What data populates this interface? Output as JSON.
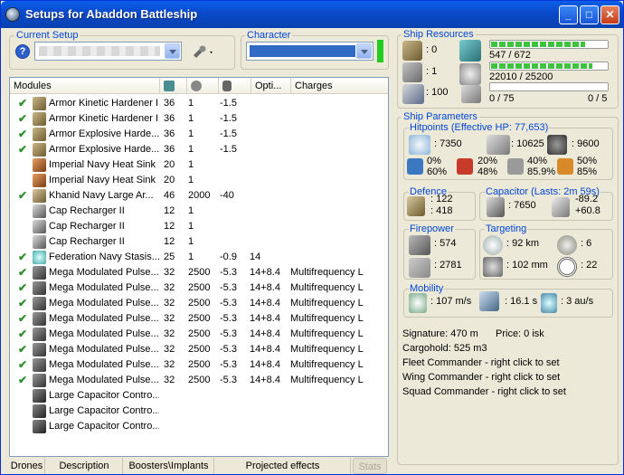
{
  "window": {
    "title": "Setups for Abaddon Battleship",
    "minimize": "_",
    "maximize": "□",
    "close": "✕"
  },
  "current_setup": {
    "label": "Current Setup",
    "value": "",
    "help": "?"
  },
  "character": {
    "label": "Character",
    "value": ""
  },
  "modules": {
    "columns": [
      "Modules",
      "",
      "",
      "",
      "Opti...",
      "Charges"
    ],
    "rows": [
      {
        "checked": true,
        "icon": "hardener-icon",
        "name": "Armor Kinetic Hardener II",
        "cpu": "36",
        "pg": "1",
        "cap": "-1.5",
        "opt": "",
        "charges": ""
      },
      {
        "checked": true,
        "icon": "hardener-icon",
        "name": "Armor Kinetic Hardener II",
        "cpu": "36",
        "pg": "1",
        "cap": "-1.5",
        "opt": "",
        "charges": ""
      },
      {
        "checked": true,
        "icon": "hardener-icon",
        "name": "Armor Explosive Harde...",
        "cpu": "36",
        "pg": "1",
        "cap": "-1.5",
        "opt": "",
        "charges": ""
      },
      {
        "checked": true,
        "icon": "hardener-icon",
        "name": "Armor Explosive Harde...",
        "cpu": "36",
        "pg": "1",
        "cap": "-1.5",
        "opt": "",
        "charges": ""
      },
      {
        "checked": false,
        "icon": "heatsink-icon",
        "name": "Imperial Navy Heat Sink",
        "cpu": "20",
        "pg": "1",
        "cap": "",
        "opt": "",
        "charges": ""
      },
      {
        "checked": false,
        "icon": "heatsink-icon",
        "name": "Imperial Navy Heat Sink",
        "cpu": "20",
        "pg": "1",
        "cap": "",
        "opt": "",
        "charges": ""
      },
      {
        "checked": true,
        "icon": "armor-repairer-icon",
        "name": "Khanid Navy Large Ar...",
        "cpu": "46",
        "pg": "2000",
        "cap": "-40",
        "opt": "",
        "charges": ""
      },
      {
        "checked": false,
        "icon": "cap-recharger-icon",
        "name": "Cap Recharger II",
        "cpu": "12",
        "pg": "1",
        "cap": "",
        "opt": "",
        "charges": ""
      },
      {
        "checked": false,
        "icon": "cap-recharger-icon",
        "name": "Cap Recharger II",
        "cpu": "12",
        "pg": "1",
        "cap": "",
        "opt": "",
        "charges": ""
      },
      {
        "checked": false,
        "icon": "cap-recharger-icon",
        "name": "Cap Recharger II",
        "cpu": "12",
        "pg": "1",
        "cap": "",
        "opt": "",
        "charges": ""
      },
      {
        "checked": true,
        "icon": "stasis-web-icon",
        "name": "Federation Navy Stasis...",
        "cpu": "25",
        "pg": "1",
        "cap": "-0.9",
        "opt": "14",
        "charges": ""
      },
      {
        "checked": true,
        "icon": "pulse-laser-icon",
        "name": "Mega Modulated Pulse...",
        "cpu": "32",
        "pg": "2500",
        "cap": "-5.3",
        "opt": "14+8.4",
        "charges": "Multifrequency L"
      },
      {
        "checked": true,
        "icon": "pulse-laser-icon",
        "name": "Mega Modulated Pulse...",
        "cpu": "32",
        "pg": "2500",
        "cap": "-5.3",
        "opt": "14+8.4",
        "charges": "Multifrequency L"
      },
      {
        "checked": true,
        "icon": "pulse-laser-icon",
        "name": "Mega Modulated Pulse...",
        "cpu": "32",
        "pg": "2500",
        "cap": "-5.3",
        "opt": "14+8.4",
        "charges": "Multifrequency L"
      },
      {
        "checked": true,
        "icon": "pulse-laser-icon",
        "name": "Mega Modulated Pulse...",
        "cpu": "32",
        "pg": "2500",
        "cap": "-5.3",
        "opt": "14+8.4",
        "charges": "Multifrequency L"
      },
      {
        "checked": true,
        "icon": "pulse-laser-icon",
        "name": "Mega Modulated Pulse...",
        "cpu": "32",
        "pg": "2500",
        "cap": "-5.3",
        "opt": "14+8.4",
        "charges": "Multifrequency L"
      },
      {
        "checked": true,
        "icon": "pulse-laser-icon",
        "name": "Mega Modulated Pulse...",
        "cpu": "32",
        "pg": "2500",
        "cap": "-5.3",
        "opt": "14+8.4",
        "charges": "Multifrequency L"
      },
      {
        "checked": true,
        "icon": "pulse-laser-icon",
        "name": "Mega Modulated Pulse...",
        "cpu": "32",
        "pg": "2500",
        "cap": "-5.3",
        "opt": "14+8.4",
        "charges": "Multifrequency L"
      },
      {
        "checked": true,
        "icon": "pulse-laser-icon",
        "name": "Mega Modulated Pulse...",
        "cpu": "32",
        "pg": "2500",
        "cap": "-5.3",
        "opt": "14+8.4",
        "charges": "Multifrequency L"
      },
      {
        "checked": false,
        "icon": "capacitor-control-icon",
        "name": "Large Capacitor Contro...",
        "cpu": "",
        "pg": "",
        "cap": "",
        "opt": "",
        "charges": ""
      },
      {
        "checked": false,
        "icon": "capacitor-control-icon",
        "name": "Large Capacitor Contro...",
        "cpu": "",
        "pg": "",
        "cap": "",
        "opt": "",
        "charges": ""
      },
      {
        "checked": false,
        "icon": "capacitor-control-icon",
        "name": "Large Capacitor Contro...",
        "cpu": "",
        "pg": "",
        "cap": "",
        "opt": "",
        "charges": ""
      }
    ]
  },
  "bottom_tabs": [
    "Drones",
    "Description",
    "Boosters\\Implants",
    "Projected effects",
    "Stats"
  ],
  "resources": {
    "label": "Ship Resources",
    "turret_slots": ": 0",
    "launcher_slots": ": 1",
    "calibration": ": 100",
    "cpu_text": "547 / 672",
    "cpu_fill": 0.814,
    "pg_text": "22010 / 25200",
    "pg_fill": 0.873,
    "drone_bay_text": "0 / 75",
    "drone_fill": 0,
    "drones_count": "0 / 5"
  },
  "params": {
    "label": "Ship Parameters",
    "hitpoints_label": "Hitpoints (Effective HP: 77,653)",
    "hp_shield": ": 7350",
    "hp_armor": ": 10625",
    "hp_structure": ": 9600",
    "res_shield": [
      "0%",
      "60%"
    ],
    "res_armor": [
      "20%",
      "48%"
    ],
    "res_hull": [
      "40%",
      "85.9%"
    ],
    "res_struct": [
      "50%",
      "85%"
    ],
    "defence_label": "Defence",
    "def_a": ": 122",
    "def_b": ": 418",
    "capacitor_label": "Capacitor (Lasts: 2m 59s)",
    "cap_amount": ": 7650",
    "cap_delta_a": "-89.2",
    "cap_delta_b": "+60.8",
    "firepower_label": "Firepower",
    "fp_a": ": 574",
    "fp_b": ": 2781",
    "targeting_label": "Targeting",
    "tgt_range": ": 92 km",
    "tgt_count": ": 6",
    "tgt_res": ": 102 mm",
    "tgt_sensor": ": 22",
    "mobility_label": "Mobility",
    "speed": ": 107 m/s",
    "align": ": 16.1 s",
    "warp": ": 3 au/s",
    "signature": "Signature: 470 m",
    "price": "Price: 0 isk",
    "cargohold": "Cargohold: 525 m3",
    "fleet_cmd": "Fleet Commander - right click to set",
    "wing_cmd": "Wing Commander - right click to set",
    "squad_cmd": "Squad Commander - right click to set"
  },
  "colors": {
    "check": "#2d8f2d",
    "label_blue": "#0046d5",
    "bar_green": "#3fc33f",
    "title_blue": "#0b49c9"
  }
}
